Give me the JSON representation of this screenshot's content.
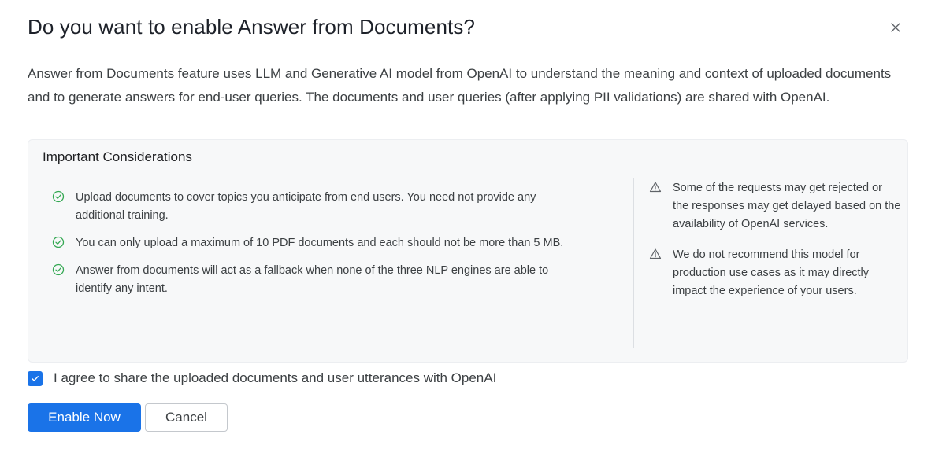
{
  "dialog": {
    "title": "Do you want to enable Answer from Documents?",
    "close_icon": "close-icon",
    "description": "Answer from Documents feature uses LLM and Generative AI model from OpenAI to understand the meaning and context of uploaded documents and to generate answers for end-user queries. The documents and user queries (after applying PII validations) are shared with OpenAI."
  },
  "considerations": {
    "title": "Important Considerations",
    "points": [
      {
        "icon": "check-circle-icon",
        "text": "Upload documents to cover topics you anticipate from end users. You need not provide any additional training."
      },
      {
        "icon": "check-circle-icon",
        "text": "You can only upload a maximum of 10 PDF documents and each should not be more than 5 MB."
      },
      {
        "icon": "check-circle-icon",
        "text": "Answer from documents will act as a fallback when none of the three NLP engines are able to identify any intent."
      }
    ],
    "warnings": [
      {
        "icon": "warning-triangle-icon",
        "text": "Some of the requests may get rejected or the responses may get delayed based on the availability of OpenAI services."
      },
      {
        "icon": "warning-triangle-icon",
        "text": "We do not recommend this model for production use cases as it may directly impact the experience of your users."
      }
    ]
  },
  "agreement": {
    "checked": true,
    "label": "I agree to share the uploaded documents and user utterances with OpenAI"
  },
  "actions": {
    "enable_label": "Enable Now",
    "cancel_label": "Cancel"
  },
  "colors": {
    "primary": "#1a73e8",
    "success": "#34a853",
    "panel_bg": "#f7f8f9"
  }
}
